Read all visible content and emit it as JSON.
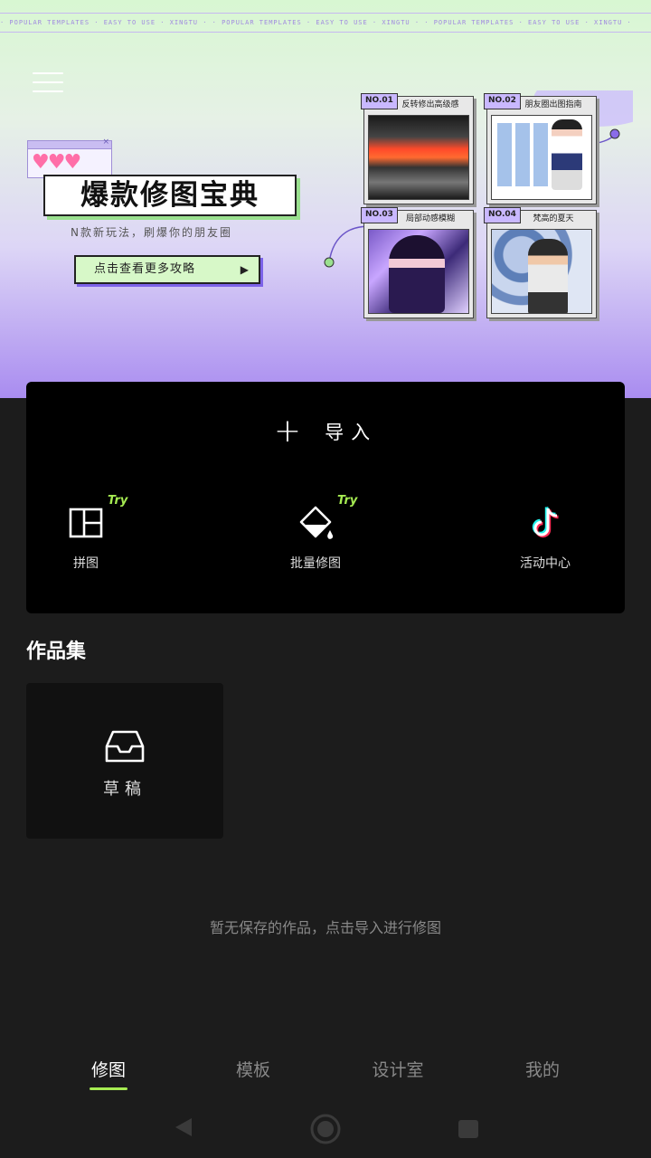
{
  "banner": {
    "marquee": "· POPULAR TEMPLATES · EASY TO USE · XINGTU · · POPULAR TEMPLATES · EASY TO USE · XINGTU · · POPULAR TEMPLATES · EASY TO USE · XINGTU ·",
    "title": "爆款修图宝典",
    "subtitle": "N款新玩法，刷爆你的朋友圈",
    "cta": "点击查看更多攻略",
    "cards": [
      {
        "tag": "NO.01",
        "caption": "反转修出高级感"
      },
      {
        "tag": "NO.02",
        "caption": "朋友圈出图指南"
      },
      {
        "tag": "NO.03",
        "caption": "局部动感模糊"
      },
      {
        "tag": "NO.04",
        "caption": "梵高的夏天"
      }
    ]
  },
  "panel": {
    "import_plus": "+",
    "import_label": "导入",
    "tools": [
      {
        "label": "拼图",
        "try": "Try",
        "icon": "collage-icon"
      },
      {
        "label": "批量修图",
        "try": "Try",
        "icon": "batch-edit-icon"
      },
      {
        "label": "活动中心",
        "icon": "tiktok-icon"
      }
    ]
  },
  "works": {
    "title": "作品集",
    "draft_label": "草稿",
    "empty_text": "暂无保存的作品，点击导入进行修图"
  },
  "nav": {
    "items": [
      "修图",
      "模板",
      "设计室",
      "我的"
    ],
    "active": "修图"
  },
  "colors": {
    "accent_green": "#a6ec52",
    "panel_bg": "#000000",
    "page_bg": "#1c1c1c"
  }
}
